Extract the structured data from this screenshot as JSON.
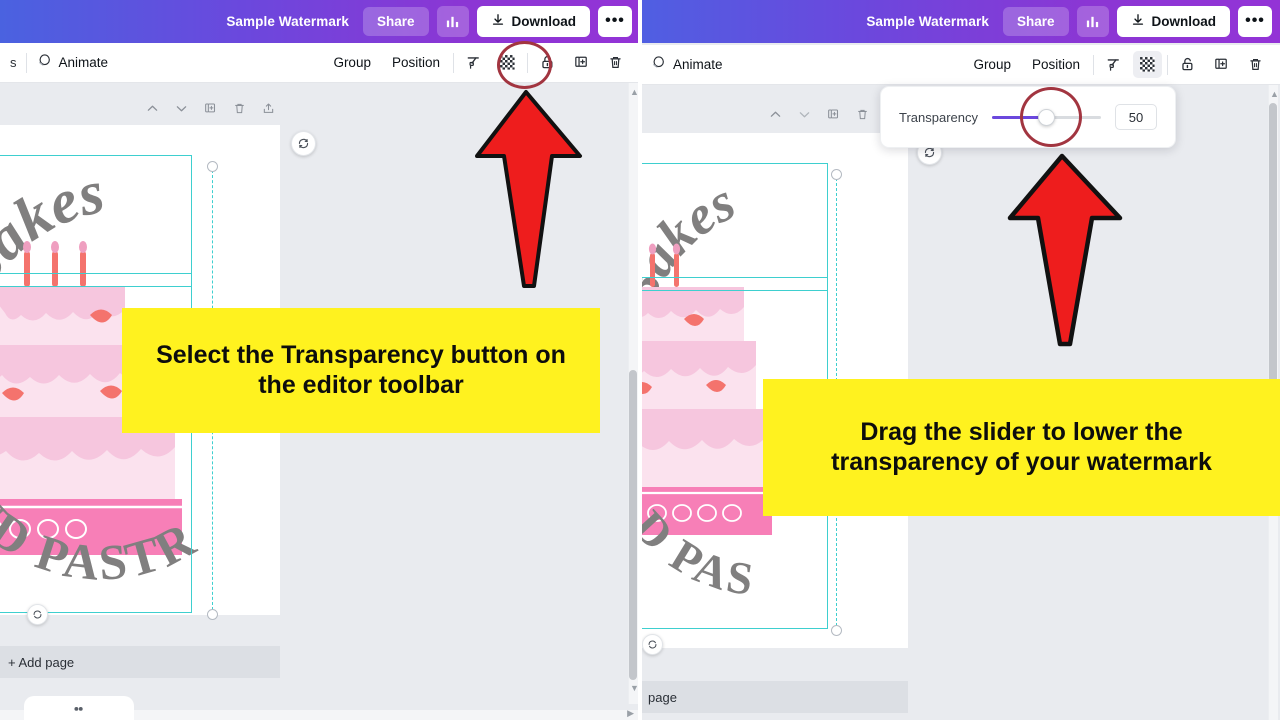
{
  "meta": {
    "accent_purple": "#8b36d4",
    "accent_blue": "#4a62e0",
    "callout_yellow": "#fff21f",
    "annotation_red": "#ee1d1d",
    "annotation_ellipse": "#a23540",
    "selection_teal": "#3ecfcf"
  },
  "panels": [
    {
      "id": "left",
      "header": {
        "title": "Sample Watermark",
        "share_label": "Share",
        "stats_icon": "bar-chart-icon",
        "download_label": "Download",
        "download_icon": "download-icon",
        "more_label": "•••"
      },
      "toolbar": {
        "truncated_label": "s",
        "animate_label": "Animate",
        "animate_icon": "animate-icon",
        "group_label": "Group",
        "position_label": "Position",
        "icons": [
          {
            "name": "color-picker-icon",
            "active": false
          },
          {
            "name": "transparency-icon",
            "active": false
          },
          {
            "name": "lock-icon",
            "active": false
          },
          {
            "name": "duplicate-icon",
            "active": false
          },
          {
            "name": "trash-icon",
            "active": false
          }
        ]
      },
      "page_tools": [
        "chevron-up-icon",
        "chevron-down-icon",
        "duplicate-page-icon",
        "delete-page-icon",
        "share-page-icon"
      ],
      "artboard": {
        "logo_top_text": "y Bakes",
        "logo_bottom_text": "ND PASTRI",
        "rotate_icon": "rotate-icon"
      },
      "page_strip_label": "+ Add page",
      "annotations": {
        "callout_text": "Select the Transparency button on the editor toolbar",
        "arrow": "red-up-arrow",
        "ellipse_target": "transparency-icon"
      }
    },
    {
      "id": "right",
      "header": {
        "title": "Sample Watermark",
        "share_label": "Share",
        "stats_icon": "bar-chart-icon",
        "download_label": "Download",
        "download_icon": "download-icon",
        "more_label": "•••"
      },
      "toolbar": {
        "animate_label": "Animate",
        "animate_icon": "animate-icon",
        "group_label": "Group",
        "position_label": "Position",
        "icons": [
          {
            "name": "color-picker-icon",
            "active": false
          },
          {
            "name": "transparency-icon",
            "active": true
          },
          {
            "name": "lock-icon",
            "active": false
          },
          {
            "name": "duplicate-icon",
            "active": false
          },
          {
            "name": "trash-icon",
            "active": false
          }
        ]
      },
      "page_tools": [
        "chevron-up-icon",
        "chevron-down-icon",
        "duplicate-page-icon",
        "delete-page-icon"
      ],
      "artboard": {
        "logo_top_text": "Bakes",
        "logo_bottom_text": "D PAS",
        "rotate_icon": "rotate-icon"
      },
      "page_strip_label": "page",
      "transparency_popover": {
        "label": "Transparency",
        "value": "50",
        "slider_percent": 50
      },
      "annotations": {
        "callout_text": "Drag the slider to lower the transparency of your watermark",
        "arrow": "red-up-arrow",
        "ellipse_target": "transparency-slider-knob"
      }
    }
  ]
}
